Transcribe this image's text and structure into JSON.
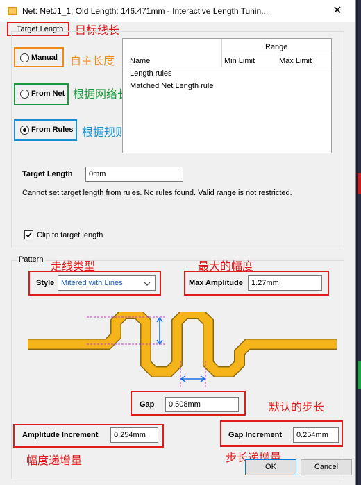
{
  "window": {
    "title": "Net: NetJ1_1;  Old Length: 146.471mm  -  Interactive Length Tunin...",
    "close_glyph": "✕"
  },
  "target_length_group": {
    "label": "Target Length",
    "annotation": "目标线长",
    "options": [
      {
        "label": "Manual",
        "annotation": "自主长度",
        "selected": false
      },
      {
        "label": "From Net",
        "annotation": "根据网络长度",
        "selected": false
      },
      {
        "label": "From Rules",
        "annotation": "根据规则长度",
        "selected": true
      }
    ]
  },
  "rules_table": {
    "group_header": "Range",
    "columns": [
      "Name",
      "Min Limit",
      "Max Limit"
    ],
    "rows": [
      "Length rules",
      "Matched Net Length rule"
    ]
  },
  "target_length_field": {
    "label": "Target Length",
    "value": "0mm"
  },
  "message": "Cannot set target length from rules. No rules found. Valid range is not restricted.",
  "clip": {
    "label": "Clip to target length",
    "checked": true
  },
  "pattern": {
    "label": "Pattern",
    "style_annotation": "走线类型",
    "style_label": "Style",
    "style_value": "Mitered with Lines",
    "max_amp_annotation": "最大的幅度",
    "max_amp_label": "Max Amplitude",
    "max_amp_value": "1.27mm",
    "gap_label": "Gap",
    "gap_value": "0.508mm",
    "gap_annotation": "默认的步长",
    "amp_inc_label": "Amplitude Increment",
    "amp_inc_value": "0.254mm",
    "amp_inc_annotation": "幅度递增量",
    "gap_inc_label": "Gap Increment",
    "gap_inc_value": "0.254mm",
    "gap_inc_annotation": "步长递增量"
  },
  "buttons": {
    "ok": "OK",
    "cancel": "Cancel"
  },
  "colors": {
    "annotation_red": "#e01b1b",
    "annotation_orange": "#f08a1d",
    "annotation_green": "#1a9a3a",
    "annotation_blue": "#1a8fd0",
    "trace_fill": "#f4b41a",
    "trace_stroke": "#8a6a10",
    "dimension_blue": "#1a6ee8",
    "dimension_magenta": "#c040c0"
  }
}
